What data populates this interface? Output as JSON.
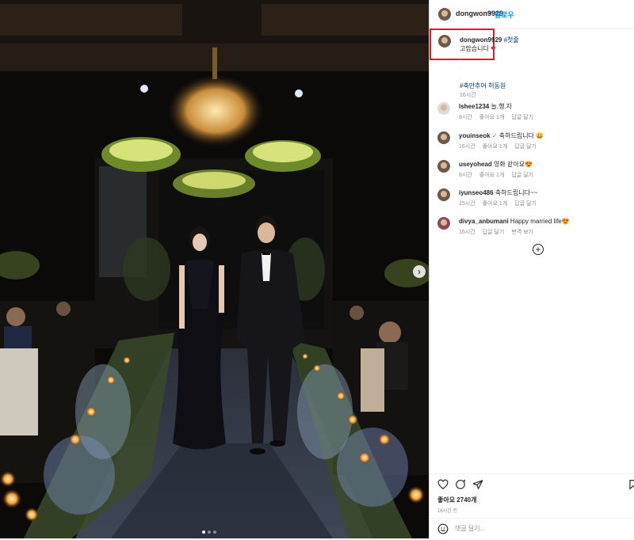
{
  "post": {
    "username": "dongwon9929",
    "follow_label": "팔로우",
    "separator": "•"
  },
  "caption": {
    "username": "dongwon9929",
    "hashtag1": "#첫줄",
    "line2": "고맙습니다",
    "heart": "❤",
    "dot1": ".",
    "dot2": ".",
    "dot3": ".",
    "hashtags": "#축만추어 허동원",
    "time": "16시간"
  },
  "comments": [
    {
      "username": "lshee1234",
      "text": "늘.행.자",
      "time": "8시간",
      "likes": "좋아요 1개",
      "reply": "답글 달기",
      "translate": ""
    },
    {
      "username": "youinseok",
      "text": "축하드립니다 😀",
      "time": "16시간",
      "likes": "좋아요 1개",
      "reply": "답글 달기",
      "translate": "",
      "verified": "✓"
    },
    {
      "username": "useyohead",
      "text": "영화 같아요😍",
      "time": "8시간",
      "likes": "좋아요 1개",
      "reply": "답글 달기",
      "translate": ""
    },
    {
      "username": "iyunseo486",
      "text": "축하드립니다~~",
      "time": "15시간",
      "likes": "좋아요 1개",
      "reply": "답글 달기",
      "translate": ""
    },
    {
      "username": "divya_anbumani",
      "text": "Happy married life😍",
      "time": "16시간",
      "likes": "",
      "reply": "답글 달기",
      "translate": "번역 보기"
    }
  ],
  "actions": {
    "likes_text": "좋아요 2740개",
    "post_time": "16시간 전",
    "comment_placeholder": "댓글 달기..."
  },
  "icons": {
    "heart": "heart-icon",
    "comment": "comment-icon",
    "share": "share-icon",
    "bookmark": "bookmark-icon",
    "emoji": "emoji-icon",
    "add": "add-circle-icon",
    "next": "chevron-right-icon"
  },
  "colors": {
    "follow": "#0095f6",
    "highlight_box": "#e31b1b",
    "hashtag": "#00376b"
  }
}
